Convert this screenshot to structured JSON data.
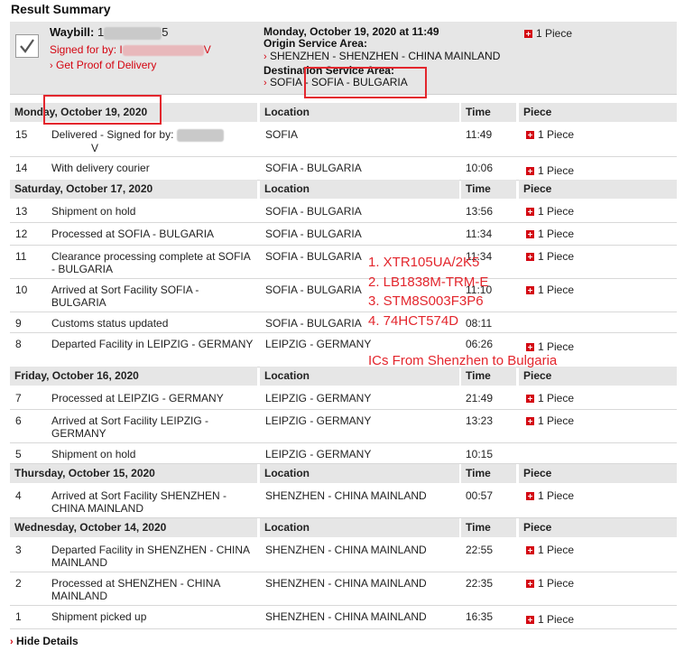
{
  "title": "Result Summary",
  "summary": {
    "waybill_label": "Waybill:",
    "waybill_prefix": "1",
    "waybill_suffix": "5",
    "signed_label": "Signed for by:",
    "signed_prefix": "I",
    "signed_suffix": "V",
    "pod_link": "Get Proof of Delivery",
    "date": "Monday, October 19, 2020 at 11:49",
    "origin_label": "Origin Service Area:",
    "origin_value": "SHENZHEN - SHENZHEN - CHINA MAINLAND",
    "dest_label": "Destination Service Area:",
    "dest_value": "SOFIA - SOFIA - BULGARIA",
    "piece": "1 Piece"
  },
  "columns": {
    "location": "Location",
    "time": "Time",
    "piece": "Piece"
  },
  "groups": [
    {
      "date": "Monday, October 19, 2020",
      "rows": [
        {
          "num": "15",
          "desc": "Delivered - Signed for by:",
          "desc_tail": "V",
          "location": "SOFIA",
          "time": "11:49",
          "piece": "1 Piece"
        },
        {
          "num": "14",
          "desc": "With delivery courier",
          "location": "SOFIA - BULGARIA",
          "time": "10:06",
          "piece": "1 Piece"
        }
      ]
    },
    {
      "date": "Saturday, October 17, 2020",
      "rows": [
        {
          "num": "13",
          "desc": "Shipment on hold",
          "location": "SOFIA - BULGARIA",
          "time": "13:56",
          "piece": "1 Piece"
        },
        {
          "num": "12",
          "desc": "Processed at SOFIA - BULGARIA",
          "location": "SOFIA - BULGARIA",
          "time": "11:34",
          "piece": "1 Piece"
        },
        {
          "num": "11",
          "desc": "Clearance processing complete at SOFIA - BULGARIA",
          "location": "SOFIA - BULGARIA",
          "time": "11:34",
          "piece": "1 Piece"
        },
        {
          "num": "10",
          "desc": "Arrived at Sort Facility SOFIA - BULGARIA",
          "location": "SOFIA - BULGARIA",
          "time": "11:10",
          "piece": "1 Piece"
        },
        {
          "num": "9",
          "desc": "Customs status updated",
          "location": "SOFIA - BULGARIA",
          "time": "08:11",
          "piece": ""
        },
        {
          "num": "8",
          "desc": "Departed Facility in LEIPZIG - GERMANY",
          "location": "LEIPZIG - GERMANY",
          "time": "06:26",
          "piece": "1 Piece"
        }
      ]
    },
    {
      "date": "Friday, October 16, 2020",
      "rows": [
        {
          "num": "7",
          "desc": "Processed at LEIPZIG - GERMANY",
          "location": "LEIPZIG - GERMANY",
          "time": "21:49",
          "piece": "1 Piece"
        },
        {
          "num": "6",
          "desc": "Arrived at Sort Facility LEIPZIG - GERMANY",
          "location": "LEIPZIG - GERMANY",
          "time": "13:23",
          "piece": "1 Piece"
        },
        {
          "num": "5",
          "desc": "Shipment on hold",
          "location": "LEIPZIG - GERMANY",
          "time": "10:15",
          "piece": ""
        }
      ]
    },
    {
      "date": "Thursday, October 15, 2020",
      "rows": [
        {
          "num": "4",
          "desc": "Arrived at Sort Facility SHENZHEN - CHINA MAINLAND",
          "location": "SHENZHEN - CHINA MAINLAND",
          "time": "00:57",
          "piece": "1 Piece"
        }
      ]
    },
    {
      "date": "Wednesday, October 14, 2020",
      "rows": [
        {
          "num": "3",
          "desc": "Departed Facility in SHENZHEN - CHINA MAINLAND",
          "location": "SHENZHEN - CHINA MAINLAND",
          "time": "22:55",
          "piece": "1 Piece"
        },
        {
          "num": "2",
          "desc": "Processed at SHENZHEN - CHINA MAINLAND",
          "location": "SHENZHEN - CHINA MAINLAND",
          "time": "22:35",
          "piece": "1 Piece"
        },
        {
          "num": "1",
          "desc": "Shipment picked up",
          "location": "SHENZHEN - CHINA MAINLAND",
          "time": "16:35",
          "piece": "1 Piece"
        }
      ]
    }
  ],
  "annotation": {
    "lines": [
      "1. XTR105UA/2K5",
      "2. LB1838M-TRM-E",
      "3. STM8S003F3P6",
      "4. 74HCT574D"
    ],
    "caption": "ICs From Shenzhen to Bulgaria"
  },
  "hide_details": "Hide Details",
  "colors": {
    "accent": "#d40511",
    "annotation": "#e3262d",
    "header_bg": "#e6e6e6"
  }
}
